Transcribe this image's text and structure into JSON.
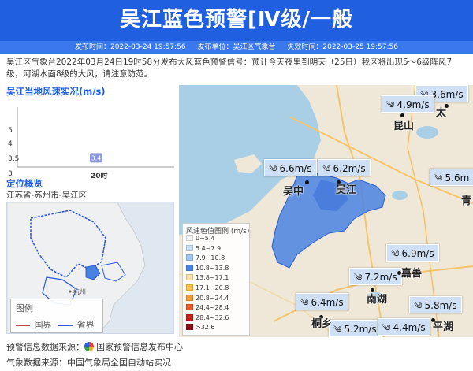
{
  "header": {
    "title": "吴江蓝色预警[Ⅳ级/一般",
    "issue_time": "发布时间：2022-03-24 19:57:56",
    "issuer": "发布单位：吴江区气象台",
    "expire_time": "失效时间：2022-03-25 19:57:56"
  },
  "description": "吴江区气象台2022年03月24日19时58分发布大风蓝色预警信号：预计今天夜里到明天（25日）我区将出现5～6级阵风7级，河湖水面8级的大风，请注意防范。",
  "realtime": {
    "title": "吴江当地风速实况(m/s)",
    "y_ticks": [
      "5",
      "4",
      "3.5",
      "3"
    ],
    "x_label": "20时"
  },
  "chart_data": {
    "type": "bar",
    "title": "吴江当地风速实况(m/s)",
    "categories": [
      "20时"
    ],
    "values": [
      3.4
    ],
    "ylim": [
      3,
      5
    ],
    "ylabel": "m/s",
    "grid": false
  },
  "location": {
    "title": "定位概览",
    "path": "江苏省-苏州市-吴江区",
    "legend_title": "图例",
    "legend_national": "国界",
    "legend_provincial": "省界",
    "city_hangzhou": "杭州"
  },
  "wind_legend": {
    "title": "风速色值图例 (m/s)",
    "items": [
      {
        "label": "0~5.4",
        "color": "#f4f4f4"
      },
      {
        "label": "5.4~7.9",
        "color": "#cfe3f7"
      },
      {
        "label": "7.9~10.8",
        "color": "#9ec6f0"
      },
      {
        "label": "10.8~13.8",
        "color": "#4a82e3"
      },
      {
        "label": "13.8~17.1",
        "color": "#f9e0a8"
      },
      {
        "label": "17.1~20.8",
        "color": "#f6c04d"
      },
      {
        "label": "20.8~24.4",
        "color": "#ef9a3a"
      },
      {
        "label": "24.4~28.4",
        "color": "#e35c2c"
      },
      {
        "label": "28.4~32.6",
        "color": "#c2231f"
      },
      {
        "label": ">32.6",
        "color": "#8c0f16"
      }
    ]
  },
  "stations": [
    {
      "speed": "3.6m/s"
    },
    {
      "speed": "4.9m/s"
    },
    {
      "speed": "6.6m/s"
    },
    {
      "speed": "6.2m/s"
    },
    {
      "speed": "5.6m"
    },
    {
      "speed": "6.9m/s"
    },
    {
      "speed": "7.2m/s"
    },
    {
      "speed": "6.4m/s"
    },
    {
      "speed": "5.8m/s"
    },
    {
      "speed": "5.2m/s"
    },
    {
      "speed": "4.4m/s"
    }
  ],
  "cities": {
    "kunshan": "昆山",
    "taicang": "太",
    "wuzhong": "吴中",
    "wujiang": "吴江",
    "qingpu": "青",
    "jiashan": "嘉善",
    "nanhu": "南湖",
    "tongxiang": "桐乡",
    "pinghu": "平湖"
  },
  "footer": {
    "warning_source_label": "预警信息数据来源：",
    "warning_source": "国家预警信息发布中心",
    "weather_source": "气象数据来源：中国气象局全国自动站实况"
  },
  "colors": {
    "brand_blue": "#1f5fe0",
    "wind_fill": "#4a82e3",
    "label_bg": "#cfe0f4"
  }
}
